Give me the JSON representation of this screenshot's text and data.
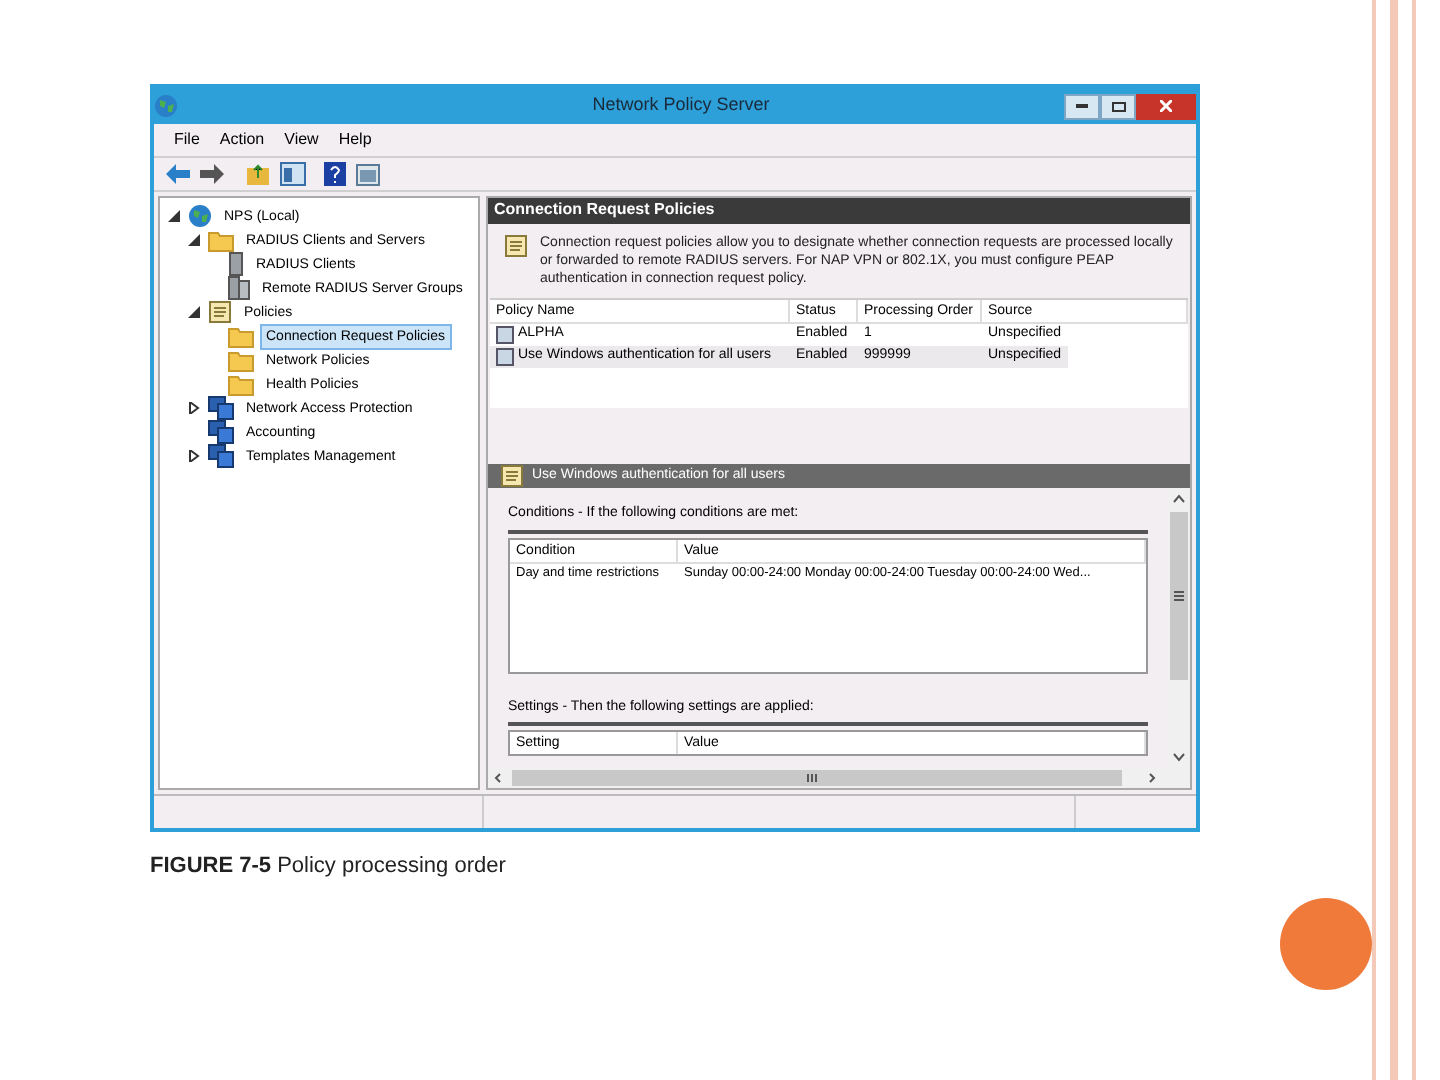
{
  "window": {
    "title": "Network Policy Server"
  },
  "menu": [
    "File",
    "Action",
    "View",
    "Help"
  ],
  "tree": [
    {
      "label": "NPS (Local)",
      "kind": "globe",
      "selected": false,
      "expanded": true,
      "children": [
        {
          "label": "RADIUS Clients and Servers",
          "kind": "folder",
          "selected": false,
          "expanded": true,
          "children": [
            {
              "label": "RADIUS Clients",
              "kind": "server",
              "selected": false
            },
            {
              "label": "Remote RADIUS Server Groups",
              "kind": "servers",
              "selected": false
            }
          ]
        },
        {
          "label": "Policies",
          "kind": "document",
          "selected": false,
          "expanded": true,
          "children": [
            {
              "label": "Connection Request Policies",
              "kind": "folder",
              "selected": true
            },
            {
              "label": "Network Policies",
              "kind": "folder",
              "selected": false
            },
            {
              "label": "Health Policies",
              "kind": "folder",
              "selected": false
            }
          ]
        },
        {
          "label": "Network Access Protection",
          "kind": "computer",
          "selected": false,
          "expanded": false
        },
        {
          "label": "Accounting",
          "kind": "computer",
          "selected": false
        },
        {
          "label": "Templates Management",
          "kind": "computer",
          "selected": false,
          "expanded": false
        }
      ]
    }
  ],
  "panel": {
    "title": "Connection Request Policies",
    "description": "Connection request policies allow you to designate whether connection requests are processed locally or forwarded to remote RADIUS servers. For NAP VPN or 802.1X, you must configure PEAP authentication in connection request policy.",
    "columns": [
      "Policy Name",
      "Status",
      "Processing Order",
      "Source"
    ],
    "rows": [
      {
        "cells": [
          "ALPHA",
          "Enabled",
          "1",
          "Unspecified"
        ],
        "selected": false
      },
      {
        "cells": [
          "Use Windows authentication for all users",
          "Enabled",
          "999999",
          "Unspecified"
        ],
        "selected": true
      }
    ]
  },
  "detail": {
    "title": "Use Windows authentication for all users",
    "conditions_heading": "Conditions - If the following conditions are met:",
    "conditions_columns": [
      "Condition",
      "Value"
    ],
    "conditions_rows": [
      [
        "Day and time restrictions",
        "Sunday 00:00-24:00 Monday 00:00-24:00 Tuesday 00:00-24:00 Wed..."
      ]
    ],
    "settings_heading": "Settings - Then the following settings are applied:",
    "settings_columns": [
      "Setting",
      "Value"
    ]
  },
  "caption": "**FIGURE 7-5** Policy processing order"
}
